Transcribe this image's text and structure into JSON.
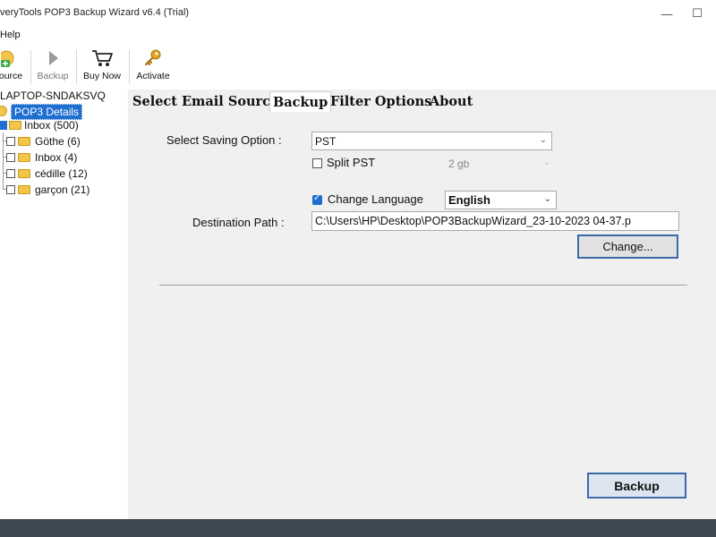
{
  "window": {
    "title": "veryTools POP3 Backup Wizard v6.4 (Trial)",
    "minimize_glyph": "—",
    "maximize_glyph": "☐"
  },
  "menu": {
    "help": "Help"
  },
  "toolbar": {
    "source": "ource",
    "backup": "Backup",
    "buy_now": "Buy Now",
    "activate": "Activate"
  },
  "tree": {
    "root": "LAPTOP-SNDAKSVQ",
    "account": "POP3 Details",
    "items": [
      {
        "label": "Inbox (500)",
        "checked": true
      },
      {
        "label": "Göthe (6)",
        "checked": false
      },
      {
        "label": "Inbox (4)",
        "checked": false
      },
      {
        "label": "cédille (12)",
        "checked": false
      },
      {
        "label": "garçon (21)",
        "checked": false
      }
    ]
  },
  "tabs": [
    {
      "label": "Select Email Source",
      "active": false
    },
    {
      "label": "Backup",
      "active": true
    },
    {
      "label": "Filter Options",
      "active": false
    },
    {
      "label": "About",
      "active": false
    }
  ],
  "backup": {
    "saving_option_label": "Select Saving Option :",
    "saving_option_value": "PST",
    "split_pst_label": "Split PST",
    "split_pst_checked": false,
    "split_size_value": "2 gb",
    "change_language_label": "Change Language",
    "change_language_checked": true,
    "language_value": "English",
    "destination_label": "Destination Path :",
    "destination_value": "C:\\Users\\HP\\Desktop\\POP3BackupWizard_23-10-2023 04-37.p",
    "change_button": "Change...",
    "backup_button": "Backup"
  },
  "colors": {
    "accent": "#1f6fd1",
    "button_border": "#3b6aa8",
    "panel_bg": "#f0f0f0",
    "taskbar": "#3e4a52"
  }
}
